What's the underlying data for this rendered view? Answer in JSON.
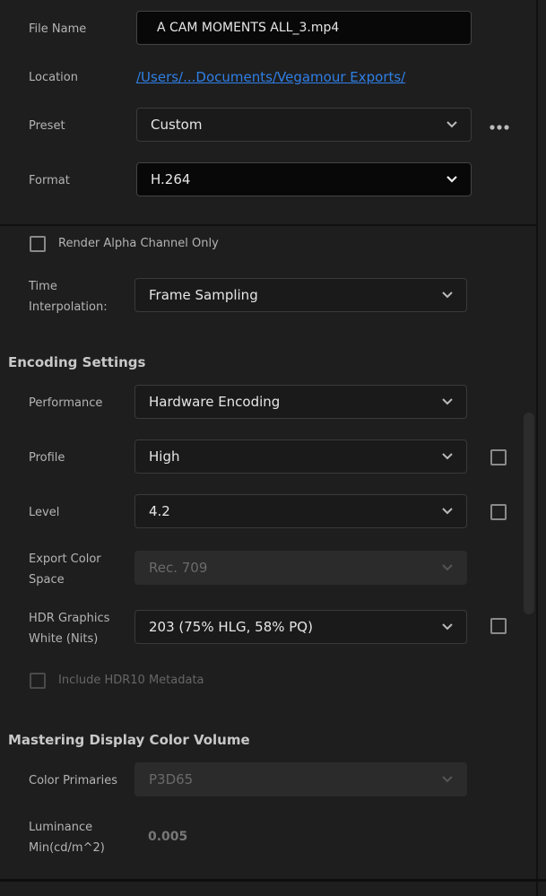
{
  "output": {
    "file_name_label": "File Name",
    "file_name_value": "A CAM MOMENTS ALL_3.mp4",
    "location_label": "Location",
    "location_value": "/Users/...Documents/Vegamour Exports/",
    "preset_label": "Preset",
    "preset_value": "Custom",
    "more_icon": "more-horizontal-icon",
    "format_label": "Format",
    "format_value": "H.264"
  },
  "video": {
    "render_alpha_label": "Render Alpha Channel Only",
    "render_alpha_checked": false,
    "time_interp_label_1": "Time",
    "time_interp_label_2": "Interpolation:",
    "time_interp_value": "Frame Sampling"
  },
  "encoding": {
    "heading": "Encoding Settings",
    "performance_label": "Performance",
    "performance_value": "Hardware Encoding",
    "profile_label": "Profile",
    "profile_value": "High",
    "level_label": "Level",
    "level_value": "4.2",
    "color_space_label_1": "Export Color",
    "color_space_label_2": "Space",
    "color_space_value": "Rec. 709",
    "hdr_white_label_1": "HDR Graphics",
    "hdr_white_label_2": "White (Nits)",
    "hdr_white_value": "203 (75% HLG, 58% PQ)",
    "hdr10_label": "Include HDR10 Metadata"
  },
  "mastering": {
    "heading": "Mastering Display Color Volume",
    "primaries_label": "Color Primaries",
    "primaries_value": "P3D65",
    "lum_min_label_1": "Luminance",
    "lum_min_label_2": "Min(cd/m^2)",
    "lum_min_value": "0.005"
  },
  "colors": {
    "background": "#1e1e1e",
    "link": "#2f7fe6"
  }
}
